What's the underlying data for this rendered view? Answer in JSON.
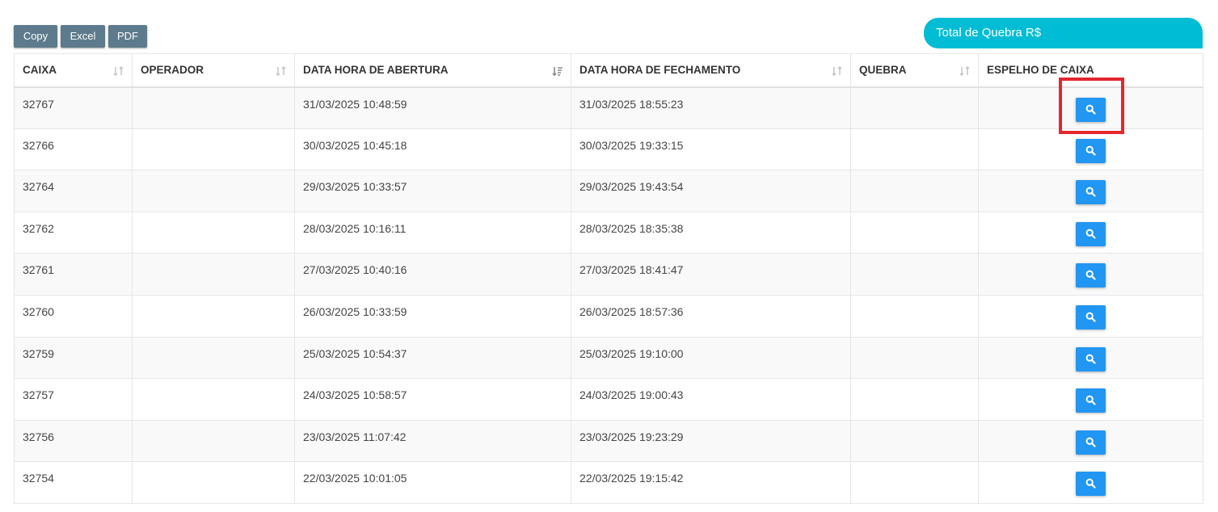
{
  "toolbar": {
    "copy_label": "Copy",
    "excel_label": "Excel",
    "pdf_label": "PDF"
  },
  "total": {
    "label": "Total de Quebra R$"
  },
  "table": {
    "headers": [
      "CAIXA",
      "OPERADOR",
      "DATA HORA DE ABERTURA",
      "DATA HORA DE FECHAMENTO",
      "QUEBRA",
      "ESPELHO DE CAIXA"
    ],
    "rows": [
      {
        "caixa": "32767",
        "operador": "",
        "abertura": "31/03/2025 10:48:59",
        "fechamento": "31/03/2025 18:55:23",
        "quebra": ""
      },
      {
        "caixa": "32766",
        "operador": "",
        "abertura": "30/03/2025 10:45:18",
        "fechamento": "30/03/2025 19:33:15",
        "quebra": ""
      },
      {
        "caixa": "32764",
        "operador": "",
        "abertura": "29/03/2025 10:33:57",
        "fechamento": "29/03/2025 19:43:54",
        "quebra": ""
      },
      {
        "caixa": "32762",
        "operador": "",
        "abertura": "28/03/2025 10:16:11",
        "fechamento": "28/03/2025 18:35:38",
        "quebra": ""
      },
      {
        "caixa": "32761",
        "operador": "",
        "abertura": "27/03/2025 10:40:16",
        "fechamento": "27/03/2025 18:41:47",
        "quebra": ""
      },
      {
        "caixa": "32760",
        "operador": "",
        "abertura": "26/03/2025 10:33:59",
        "fechamento": "26/03/2025 18:57:36",
        "quebra": ""
      },
      {
        "caixa": "32759",
        "operador": "",
        "abertura": "25/03/2025 10:54:37",
        "fechamento": "25/03/2025 19:10:00",
        "quebra": ""
      },
      {
        "caixa": "32757",
        "operador": "",
        "abertura": "24/03/2025 10:58:57",
        "fechamento": "24/03/2025 19:00:43",
        "quebra": ""
      },
      {
        "caixa": "32756",
        "operador": "",
        "abertura": "23/03/2025 11:07:42",
        "fechamento": "23/03/2025 19:23:29",
        "quebra": ""
      },
      {
        "caixa": "32754",
        "operador": "",
        "abertura": "22/03/2025 10:01:05",
        "fechamento": "22/03/2025 19:15:42",
        "quebra": ""
      }
    ]
  },
  "icons": {
    "sort": "sort-both-icon",
    "sort_active": "sort-desc-icon",
    "view": "search-icon"
  },
  "colors": {
    "toolbar_button": "#5d7b8c",
    "total_pill": "#00bcd4",
    "view_button": "#2196f3",
    "highlight": "#e5262d"
  }
}
